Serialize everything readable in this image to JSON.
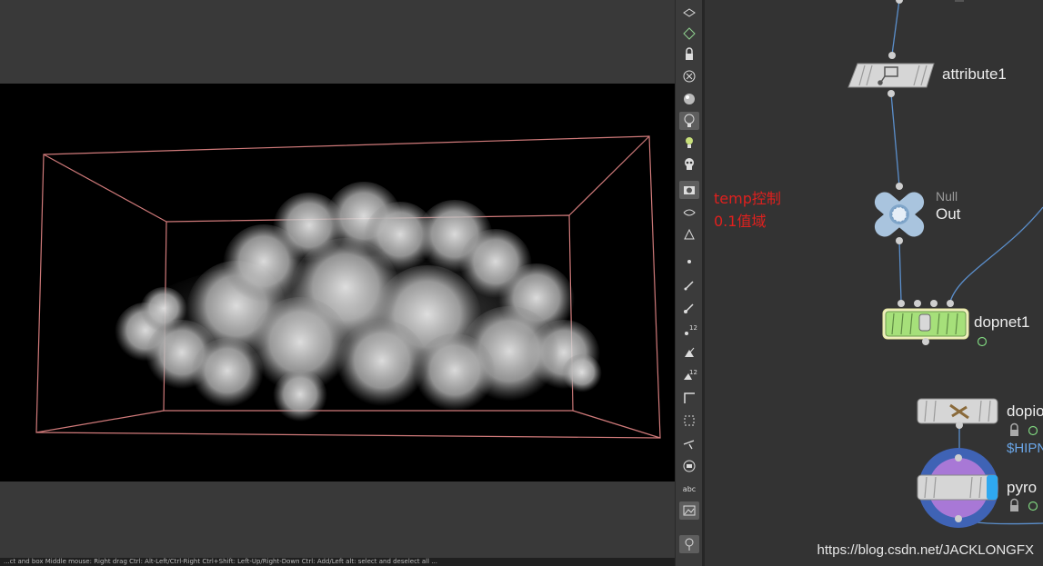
{
  "viewport": {
    "status_text": "...ct and box  Middle mouse: Right drag  Ctrl: Alt-Left/Ctrl-Right  Ctrl+Shift: Left-Up/Right-Down  Ctrl: Add/Left alt: select and deselect all ..."
  },
  "toolbar": {
    "items": [
      {
        "icon": "display-options-icon"
      },
      {
        "icon": "show-template-icon"
      },
      {
        "icon": "lock-icon"
      },
      {
        "icon": "close-x-icon"
      },
      {
        "icon": "sphere-shading-icon"
      },
      {
        "icon": "light-bulb-icon"
      },
      {
        "icon": "headlight-icon"
      },
      {
        "icon": "skull-icon"
      },
      {
        "icon": "camera-render-icon"
      },
      {
        "icon": "visualize-icon"
      },
      {
        "icon": "snap-icon"
      },
      {
        "icon": "point-icon"
      },
      {
        "icon": "normal-icon"
      },
      {
        "icon": "point-normal-icon"
      },
      {
        "icon": "point-number-icon"
      },
      {
        "icon": "prim-normal-icon"
      },
      {
        "icon": "prim-number-icon"
      },
      {
        "icon": "uv-border-icon"
      },
      {
        "icon": "hull-icon"
      },
      {
        "icon": "vector-icon"
      },
      {
        "icon": "circle-stop-icon"
      },
      {
        "icon": "text-abc-icon"
      },
      {
        "icon": "background-image-icon"
      },
      {
        "icon": "pin-icon"
      }
    ],
    "abc_label": "abc"
  },
  "network": {
    "note_line1": "temp控制",
    "note_line2": "0.1值域",
    "nodes": {
      "attribute1": {
        "label": "attribute1"
      },
      "null_out": {
        "type": "Null",
        "label": "Out"
      },
      "dopnet1": {
        "label": "dopnet1"
      },
      "dopio": {
        "label": "dopio",
        "expr": "$HIPN"
      },
      "pyro": {
        "label": "pyro"
      }
    },
    "watermark": "https://blog.csdn.net/JACKLONGFX"
  },
  "colors": {
    "note_red": "#e0201e",
    "dopnet_green": "#a6e07a",
    "wire_blue": "#5b8fcc",
    "bbox_pink": "#d07a7a"
  }
}
